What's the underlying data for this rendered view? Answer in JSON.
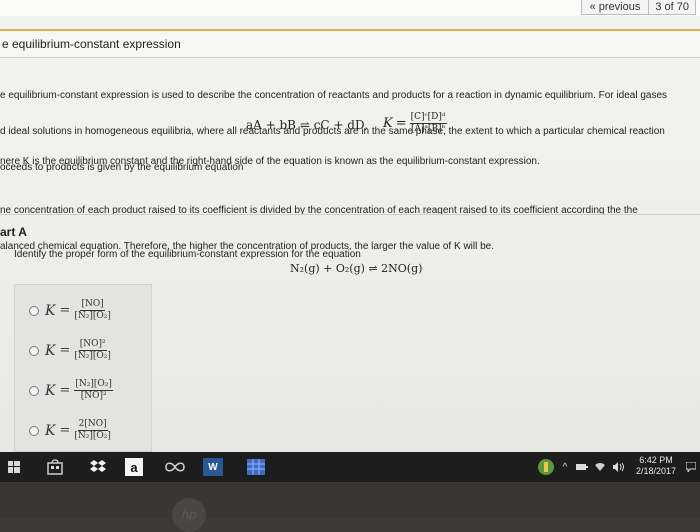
{
  "nav": {
    "previous": "« previous",
    "page_indicator": "3 of 70"
  },
  "page": {
    "title": "e equilibrium-constant expression",
    "intro_lines": [
      "e equilibrium-constant expression is used to describe the concentration of reactants and products for a reaction in dynamic equilibrium. For ideal gases",
      "d ideal solutions in homogeneous equilibria, where all reactants and products are in the same phase, the extent to which a particular chemical reaction",
      "oceeds to products is given by the equilibrium equation"
    ],
    "general_equation": "aA + bB ⇌ cC + dD,",
    "k_symbol": "K",
    "k_numerator": "[C]ᶜ[D]ᵈ",
    "k_denominator": "[A]ᵃ[B]ᵇ",
    "para2": "nere K is the equilibrium constant and the right-hand side of the equation is known as the equilibrium-constant expression.",
    "para3_lines": [
      "ne concentration of each product raised to its coefficient is divided by the concentration of each reagent raised to its coefficient according the the",
      "alanced chemical equation. Therefore, the higher the concentration of products, the larger the value of K will be."
    ]
  },
  "part": {
    "heading": "art A",
    "question": "Identify the proper form of the equilibrium-constant expression for the equation",
    "reaction": "N₂(g) + O₂(g) ⇌ 2NO(g)",
    "options": [
      {
        "k": "K",
        "numerator": "[NO]",
        "denominator": "[N₂][O₂]"
      },
      {
        "k": "K",
        "numerator": "[NO]²",
        "denominator": "[N₂][O₂]"
      },
      {
        "k": "K",
        "numerator": "[N₂][O₂]",
        "denominator": "[NO]²"
      },
      {
        "k": "K",
        "numerator": "2[NO]",
        "denominator": "[N₂][O₂]"
      }
    ]
  },
  "taskbar": {
    "amazon_label": "a",
    "word_label": "W",
    "time": "6:42 PM",
    "date": "2/18/2017"
  },
  "bezel": {
    "logo_text": "hp"
  },
  "colors": {
    "accent_rule": "#e0b257",
    "taskbar": "#1d1d1e",
    "word_blue": "#2b5797",
    "dropbox_blue": "#2f8cf0"
  }
}
